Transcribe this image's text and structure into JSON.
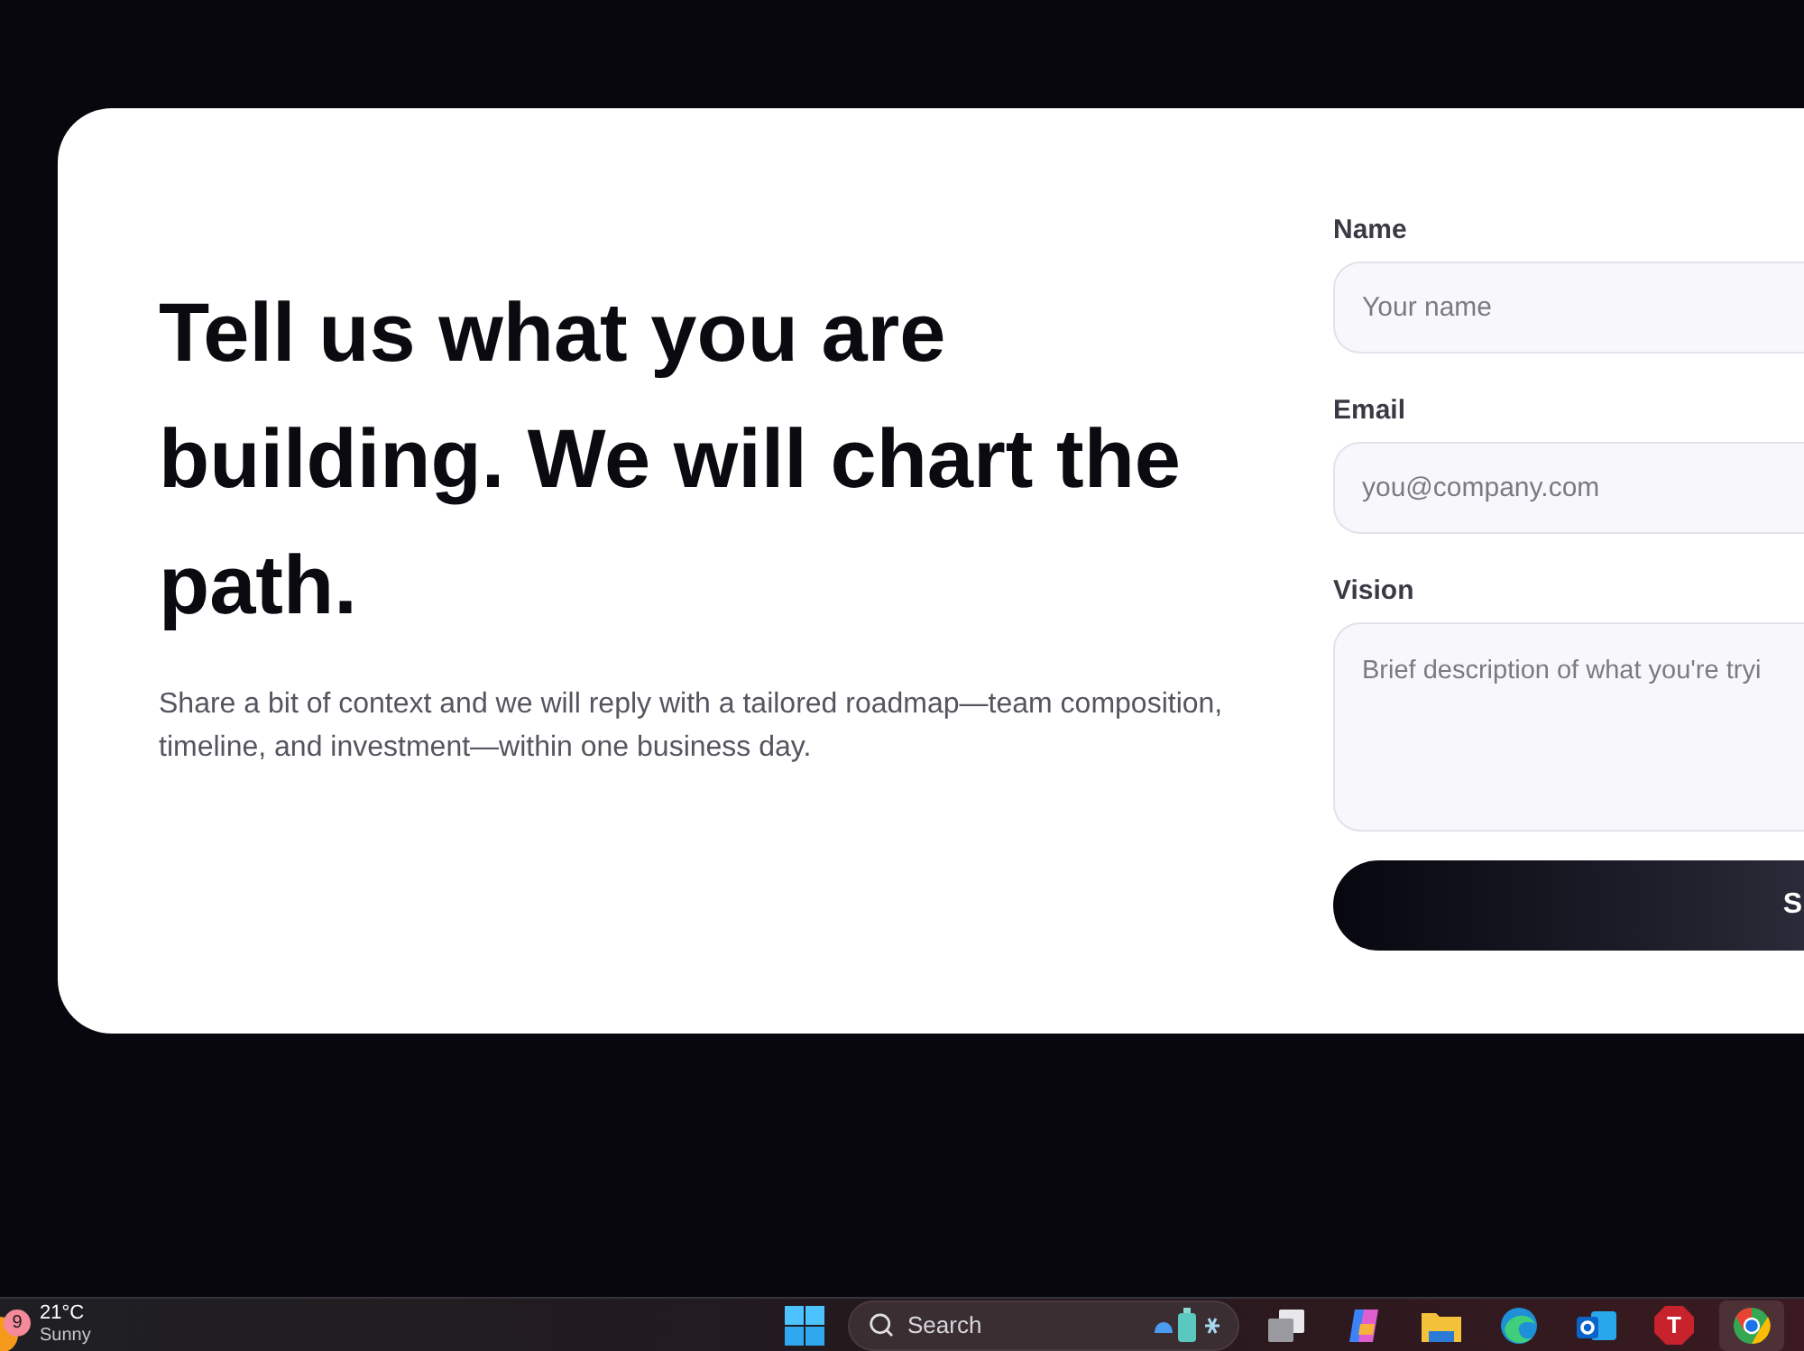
{
  "hero": {
    "heading": "Tell us what you are building. We will chart the path.",
    "description": "Share a bit of context and we will reply with a tailored roadmap—team composition, timeline, and investment—within one business day."
  },
  "form": {
    "fields": [
      {
        "kind": "input",
        "label": "Name",
        "placeholder": "Your name"
      },
      {
        "kind": "input",
        "label": "Email",
        "placeholder": "you@company.com"
      },
      {
        "kind": "textarea",
        "label": "Vision",
        "placeholder": "Brief description of what you're tryi"
      }
    ],
    "submit": {
      "label": "S"
    }
  },
  "taskbar": {
    "weather": {
      "badge": "9",
      "temperature": "21°C",
      "condition": "Sunny"
    },
    "search": {
      "label": "Search"
    },
    "apps": [
      {
        "kind": "task-view",
        "selected": false
      },
      {
        "kind": "copilot",
        "selected": false
      },
      {
        "kind": "folder",
        "selected": false
      },
      {
        "kind": "edge",
        "selected": false
      },
      {
        "kind": "mail",
        "selected": false
      },
      {
        "kind": "letter",
        "label": "T",
        "selected": false
      },
      {
        "kind": "chrome",
        "selected": true
      }
    ]
  }
}
